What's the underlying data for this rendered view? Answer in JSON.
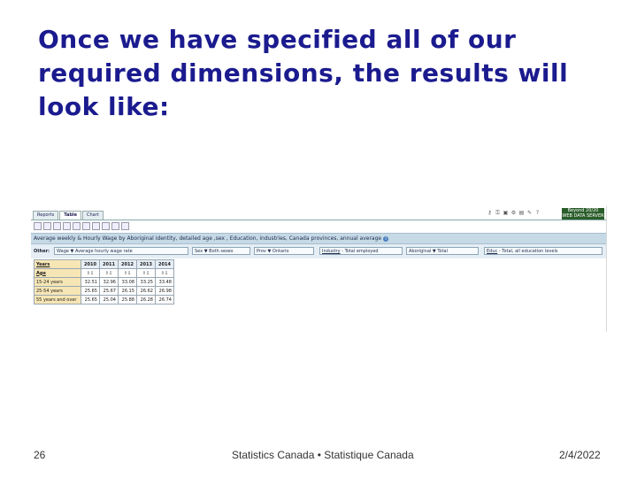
{
  "slide": {
    "title": "Once we have specified all of our required dimensions, the results will look like:",
    "page_number": "26",
    "footer_center": "Statistics Canada • Statistique Canada",
    "date": "2/4/2022"
  },
  "app": {
    "tabs": [
      "Reports",
      "Table",
      "Chart"
    ],
    "active_tab": "Table",
    "beyond_logo": [
      "Beyond 20/20",
      "WEB DATA SERVER"
    ],
    "table_title": "Average weekly & Hourly Wage by Aboriginal identity, detailed age ,sex , Education, industries, Canada provinces, annual average",
    "other_label": "Other:",
    "dimensions": [
      {
        "name": "Wage",
        "value": "▼ Average hourly wage rate"
      },
      {
        "name": "Sex",
        "value": "▼ Both sexes"
      },
      {
        "name": "Prov",
        "value": "▼ Ontario"
      },
      {
        "name": "Industry",
        "value": "- Total employed"
      },
      {
        "name": "Aboriginal",
        "value": "▼ Total"
      },
      {
        "name": "Educ",
        "value": "- Total, all education levels"
      }
    ],
    "table": {
      "years_label": "Years",
      "age_label": "Age",
      "years": [
        "2010",
        "2011",
        "2012",
        "2013",
        "2014"
      ],
      "sort_arrows": "⇧⇩",
      "rows": [
        {
          "label": "15-24 years",
          "values": [
            "32.51",
            "32.96",
            "33.08",
            "33.25",
            "33.48"
          ]
        },
        {
          "label": "25-54 years",
          "values": [
            "25.65",
            "25.67",
            "26.15",
            "26.62",
            "26.98"
          ]
        },
        {
          "label": "55 years and over",
          "values": [
            "25.65",
            "25.04",
            "25.88",
            "26.28",
            "26.74"
          ]
        }
      ]
    }
  }
}
